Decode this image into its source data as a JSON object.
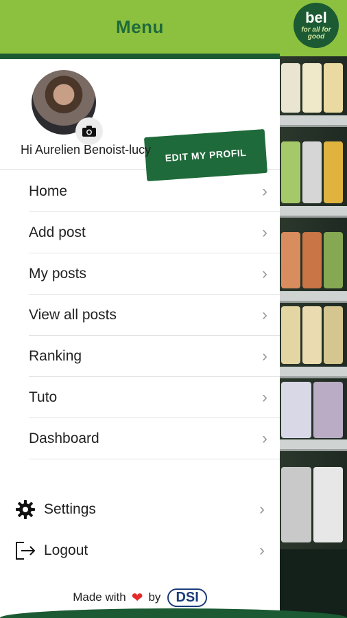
{
  "header": {
    "title": "Menu"
  },
  "brand": {
    "line1": "bel",
    "line2": "for all for good"
  },
  "profile": {
    "edit_label": "EDIT MY PROFIL",
    "greeting": "Hi Aurelien Benoist-lucy",
    "camera_icon": "camera-icon"
  },
  "menu": {
    "items": [
      {
        "label": "Home"
      },
      {
        "label": "Add post"
      },
      {
        "label": "My posts"
      },
      {
        "label": "View all posts"
      },
      {
        "label": "Ranking"
      },
      {
        "label": "Tuto"
      },
      {
        "label": "Dashboard"
      }
    ]
  },
  "bottom": {
    "settings_label": "Settings",
    "logout_label": "Logout"
  },
  "footer": {
    "made_with": "Made with",
    "by": "by",
    "logo_text": "DSI"
  },
  "colors": {
    "brand_green": "#8cc13f",
    "dark_green": "#1b5a33",
    "button_green": "#1f6a3a"
  }
}
